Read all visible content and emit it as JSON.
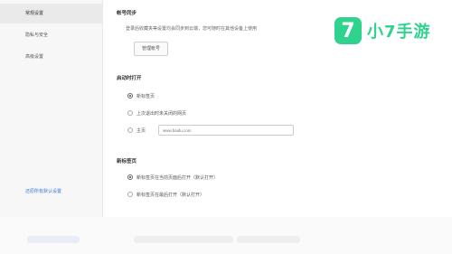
{
  "sidebar": {
    "items": [
      {
        "label": "常规设置"
      },
      {
        "label": "隐私与安全"
      },
      {
        "label": "高级设置"
      }
    ],
    "footer_link": "还原所有默认设置"
  },
  "account": {
    "title": "帐号同步",
    "description": "登录后收藏夹等设置均会同步到云端，您可随时在其他设备上使用",
    "button": "管理帐号"
  },
  "startup": {
    "title": "启动时打开",
    "options": [
      {
        "label": "新标签页",
        "checked": true
      },
      {
        "label": "上次退出时未关闭的网页",
        "checked": false
      },
      {
        "label": "主页",
        "checked": false
      }
    ],
    "url_placeholder": "www.baidu.com"
  },
  "new_tab": {
    "title": "新标签页",
    "options": [
      {
        "label": "新标签页在当前页面后打开（默认打开）",
        "checked": true
      },
      {
        "label": "新标签页在最后打开（默认打开）",
        "checked": false
      }
    ]
  },
  "logo": {
    "badge": "7",
    "text": "小7手游"
  },
  "colors": {
    "accent": "#2fd38e",
    "link": "#3a7bd5"
  }
}
